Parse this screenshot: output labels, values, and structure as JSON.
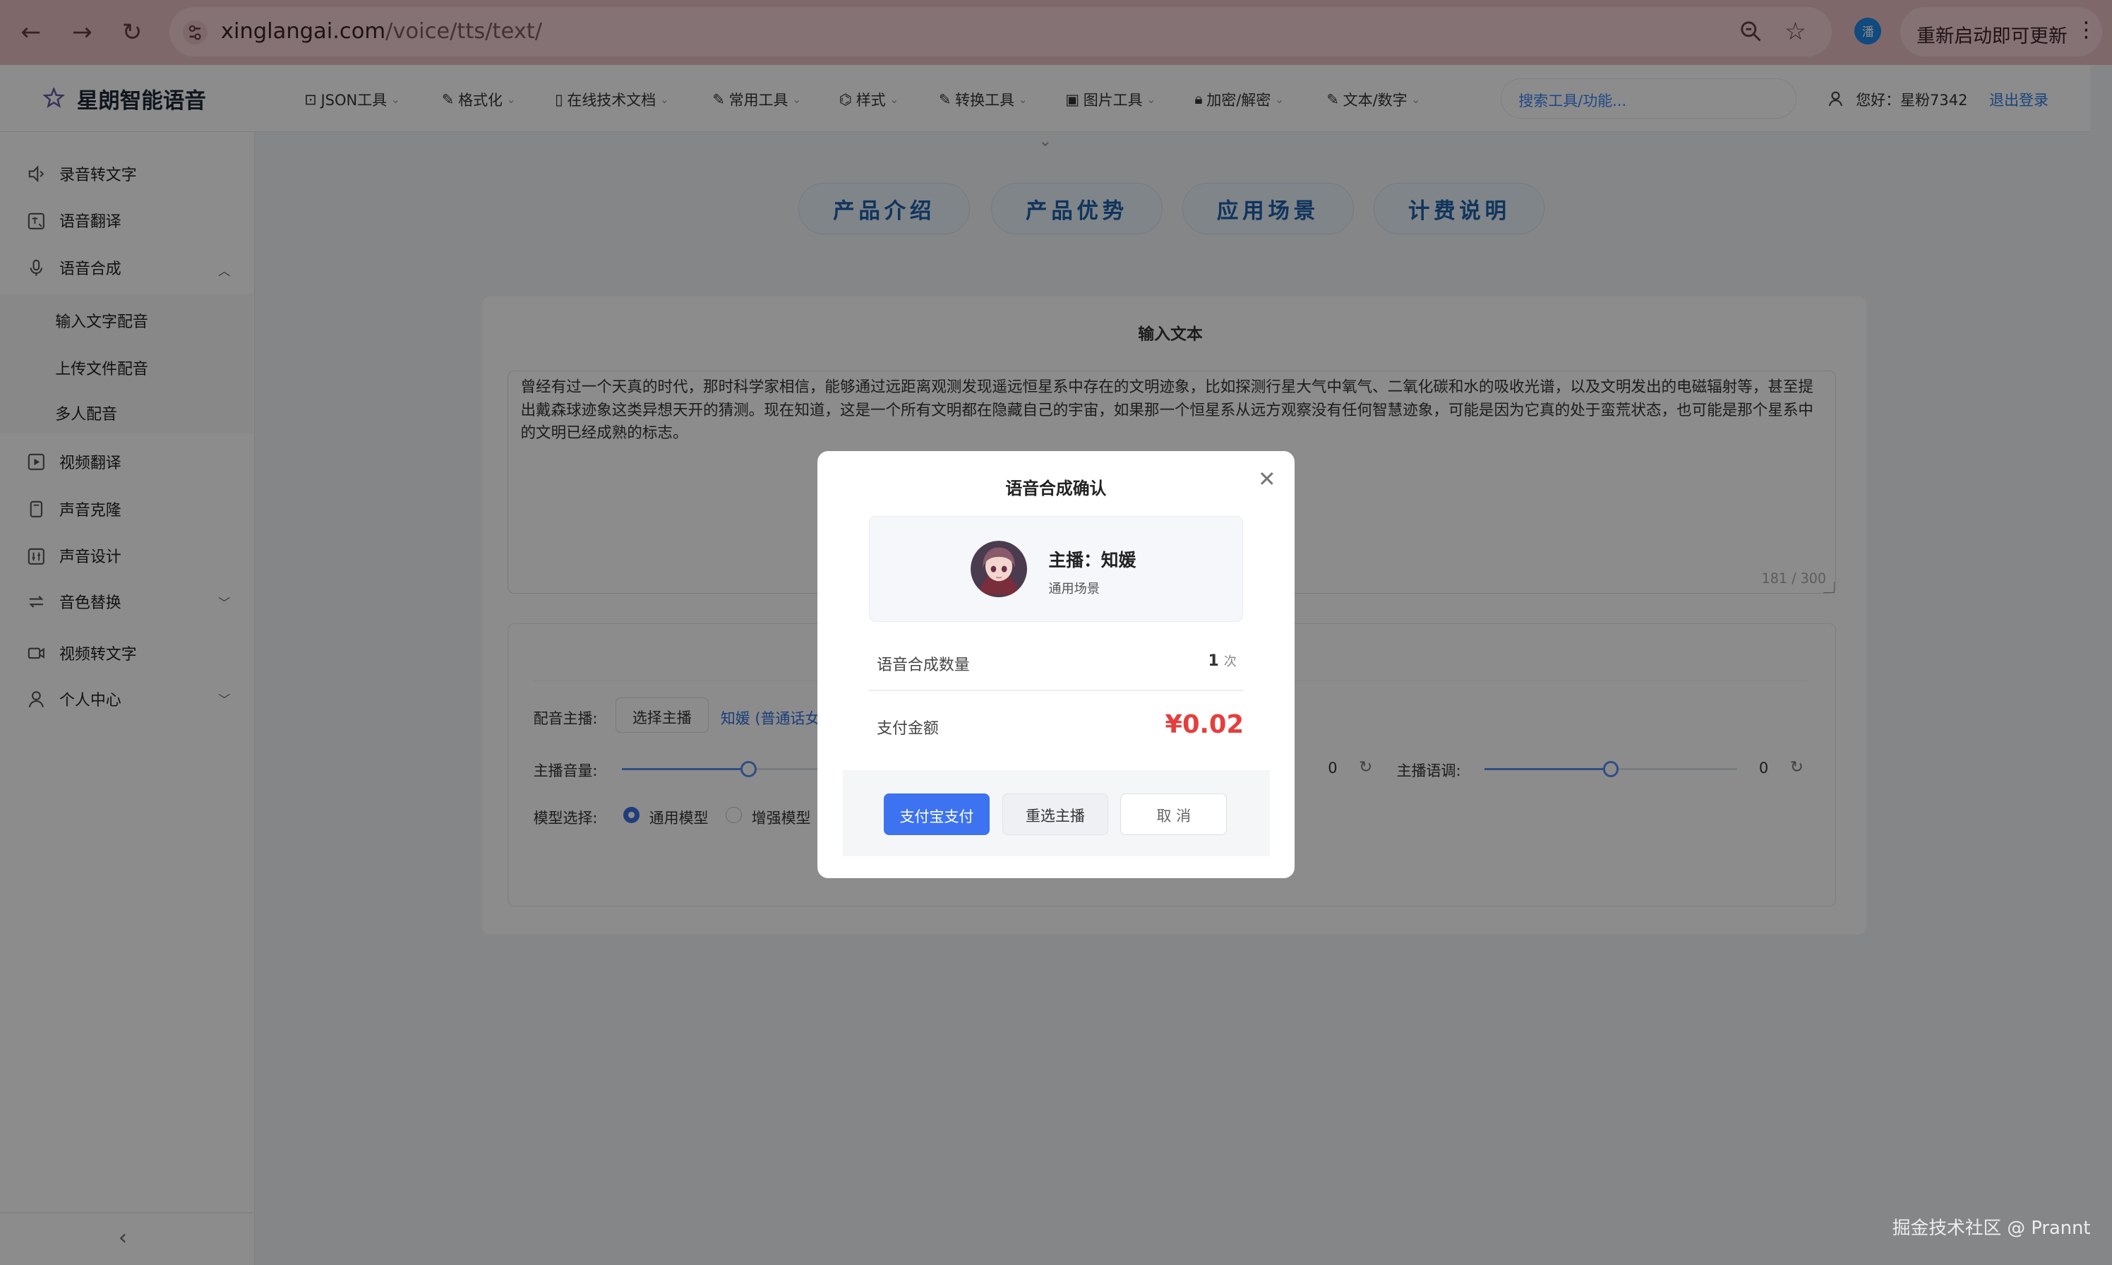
{
  "browser": {
    "url_host": "xinglangai.com",
    "url_path": "/voice/tts/text/",
    "profile_initial": "潘",
    "update_label": "重新启动即可更新"
  },
  "header": {
    "logo_text": "星朗智能语音",
    "nav": [
      {
        "label": "JSON工具"
      },
      {
        "label": "格式化"
      },
      {
        "label": "在线技术文档"
      },
      {
        "label": "常用工具"
      },
      {
        "label": "样式"
      },
      {
        "label": "转换工具"
      },
      {
        "label": "图片工具"
      },
      {
        "label": "加密/解密"
      },
      {
        "label": "文本/数字"
      }
    ],
    "search_placeholder": "搜索工具/功能...",
    "greeting": "您好：星粉7342",
    "logout": "退出登录"
  },
  "sidebar": {
    "items": [
      {
        "label": "录音转文字"
      },
      {
        "label": "语音翻译"
      },
      {
        "label": "语音合成"
      },
      {
        "label": "输入文字配音"
      },
      {
        "label": "上传文件配音"
      },
      {
        "label": "多人配音"
      },
      {
        "label": "视频翻译"
      },
      {
        "label": "声音克隆"
      },
      {
        "label": "声音设计"
      },
      {
        "label": "音色替换"
      },
      {
        "label": "视频转文字"
      },
      {
        "label": "个人中心"
      }
    ],
    "collapse_icon": "‹"
  },
  "main": {
    "pills": [
      {
        "label": "产品介绍"
      },
      {
        "label": "产品优势"
      },
      {
        "label": "应用场景"
      },
      {
        "label": "计费说明"
      }
    ],
    "input_title": "输入文本",
    "text": "曾经有过一个天真的时代，那时科学家相信，能够通过远距离观测发现遥远恒星系中存在的文明迹象，比如探测行星大气中氧气、二氧化碳和水的吸收光谱，以及文明发出的电磁辐射等，甚至提出戴森球迹象这类异想天开的猜测。现在知道，这是一个所有文明都在隐藏自己的宇宙，如果那一个恒星系从远方观察没有任何智慧迹象，可能是因为它真的处于蛮荒状态，也可能是那个星系中的文明已经成熟的标志。",
    "char_count": "181 / 300",
    "anchor_label": "配音主播:",
    "select_anchor_button": "选择主播",
    "anchor_selected": "知媛 (普通话女",
    "volume_label": "主播音量:",
    "volume_level": 0.5,
    "rate_value": "0",
    "pitch_label": "主播语调:",
    "pitch_value": "0",
    "pitch_level": 0.5,
    "model_label": "模型选择:",
    "model_options": [
      {
        "label": "通用模型",
        "checked": true
      },
      {
        "label": "增强模型",
        "checked": false
      }
    ]
  },
  "modal": {
    "title": "语音合成确认",
    "anchor_name": "主播：知媛",
    "anchor_scene": "通用场景",
    "count_label": "语音合成数量",
    "count_value": "1",
    "count_unit": "次",
    "amount_label": "支付金额",
    "amount_value": "¥0.02",
    "pay_button": "支付宝支付",
    "reselect_button": "重选主播",
    "cancel_button": "取 消"
  },
  "watermark": "掘金技术社区 @ Prannt",
  "colors": {
    "chrome": "#e8bec1",
    "primary": "#3b82f6",
    "price": "#e53e3e",
    "pill_text": "#1e5fa8"
  }
}
